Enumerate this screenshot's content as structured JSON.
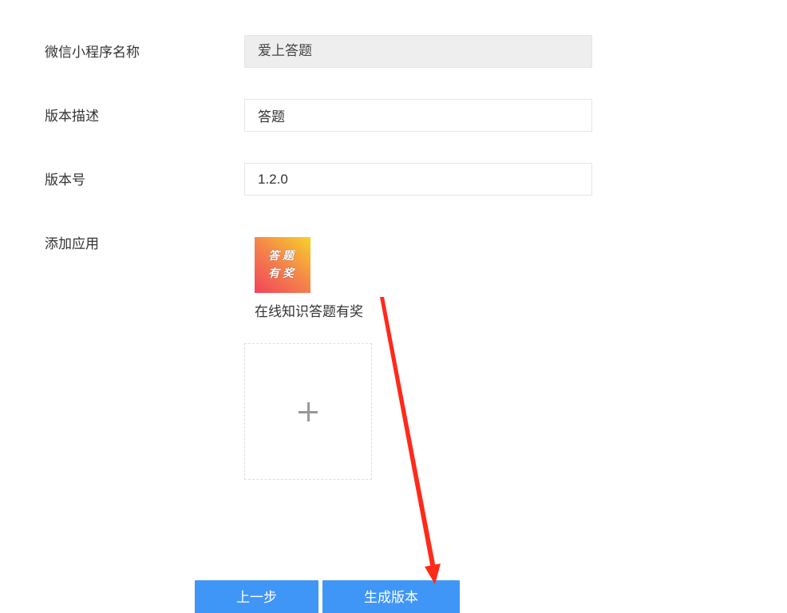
{
  "form": {
    "mini_program_name": {
      "label": "微信小程序名称",
      "value": "爱上答题"
    },
    "version_description": {
      "label": "版本描述",
      "value": "答题"
    },
    "version_number": {
      "label": "版本号",
      "value": "1.2.0"
    },
    "add_app": {
      "label": "添加应用",
      "apps": [
        {
          "thumb_text_line1": "答题",
          "thumb_text_line2": "有奖",
          "name": "在线知识答题有奖"
        }
      ],
      "add_icon": "plus-icon"
    }
  },
  "buttons": {
    "prev_label": "上一步",
    "generate_label": "生成版本"
  },
  "annotation": {
    "icon": "red-arrow",
    "color": "#ff2a1a"
  },
  "colors": {
    "primary": "#4096f7",
    "readonly_bg": "#eeeeee"
  }
}
